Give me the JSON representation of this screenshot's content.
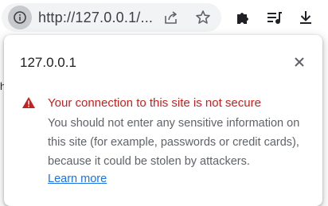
{
  "toolbar": {
    "url": "http://127.0.0.1/...",
    "icons": {
      "site_info": "info-icon",
      "share": "share-icon",
      "bookmark": "star-icon",
      "extensions": "puzzle-icon",
      "media": "media-queue-icon",
      "download": "download-icon"
    }
  },
  "page": {
    "visible_letter": "h"
  },
  "popup": {
    "title": "127.0.0.1",
    "close_icon": "close-icon",
    "warning_icon": "warning-icon",
    "warning_title": "Your connection to this site is not secure",
    "warning_body": "You should not enter any sensitive information on this site (for example, passwords or credit cards), because it could be stolen by attackers.",
    "learn_more": "Learn more"
  },
  "colors": {
    "warning_red": "#c5221f",
    "link_blue": "#1a73e8",
    "omnibox_bg": "#f1f3f4",
    "body_text": "#5f6368"
  }
}
